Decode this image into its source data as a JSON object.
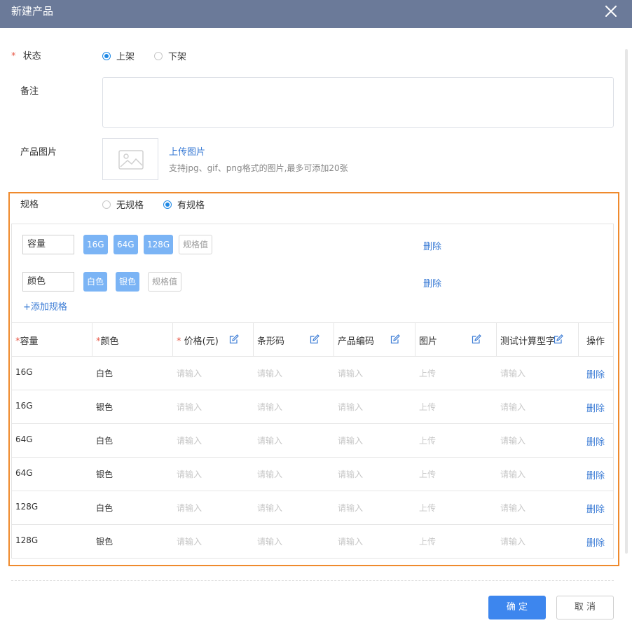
{
  "dialog": {
    "title": "新建产品"
  },
  "form": {
    "status": {
      "required_mark": "*",
      "label": "状态",
      "options": [
        {
          "label": "上架",
          "checked": true
        },
        {
          "label": "下架",
          "checked": false
        }
      ]
    },
    "remark": {
      "label": "备注",
      "value": ""
    },
    "image": {
      "label": "产品图片",
      "upload_link": "上传图片",
      "hint": "支持jpg、gif、png格式的图片,最多可添加20张"
    },
    "spec": {
      "label": "规格",
      "options": [
        {
          "label": "无规格",
          "checked": false
        },
        {
          "label": "有规格",
          "checked": true
        }
      ],
      "groups": [
        {
          "name": "容量",
          "values": [
            "16G",
            "64G",
            "128G"
          ],
          "add_placeholder": "规格值",
          "delete_label": "删除"
        },
        {
          "name": "颜色",
          "values": [
            "白色",
            "银色"
          ],
          "add_placeholder": "规格值",
          "delete_label": "删除"
        }
      ],
      "add_spec_link": "+添加规格"
    }
  },
  "table": {
    "headers": [
      {
        "required": "*",
        "label": "容量"
      },
      {
        "required": "*",
        "label": "颜色"
      },
      {
        "required": "* ",
        "label": "价格(元)"
      },
      {
        "required": "",
        "label": "条形码"
      },
      {
        "required": "",
        "label": "产品编码"
      },
      {
        "required": "",
        "label": "图片"
      },
      {
        "required": "",
        "label": "测试计算型字"
      },
      {
        "required": "",
        "label": "操作"
      }
    ],
    "rows": [
      [
        "16G",
        "白色"
      ],
      [
        "16G",
        "银色"
      ],
      [
        "64G",
        "白色"
      ],
      [
        "64G",
        "银色"
      ],
      [
        "128G",
        "白色"
      ],
      [
        "128G",
        "银色"
      ]
    ],
    "input_placeholder": "请输入",
    "upload_placeholder": "上传",
    "row_delete_label": "删除"
  },
  "footer": {
    "confirm_label": "确 定",
    "cancel_label": "取 消"
  },
  "colors": {
    "header_bg": "#6b7a99",
    "accent": "#3d86ee",
    "chip": "#7bb4f5",
    "highlight_border": "#ef8a2d",
    "required": "#e85b4a"
  }
}
